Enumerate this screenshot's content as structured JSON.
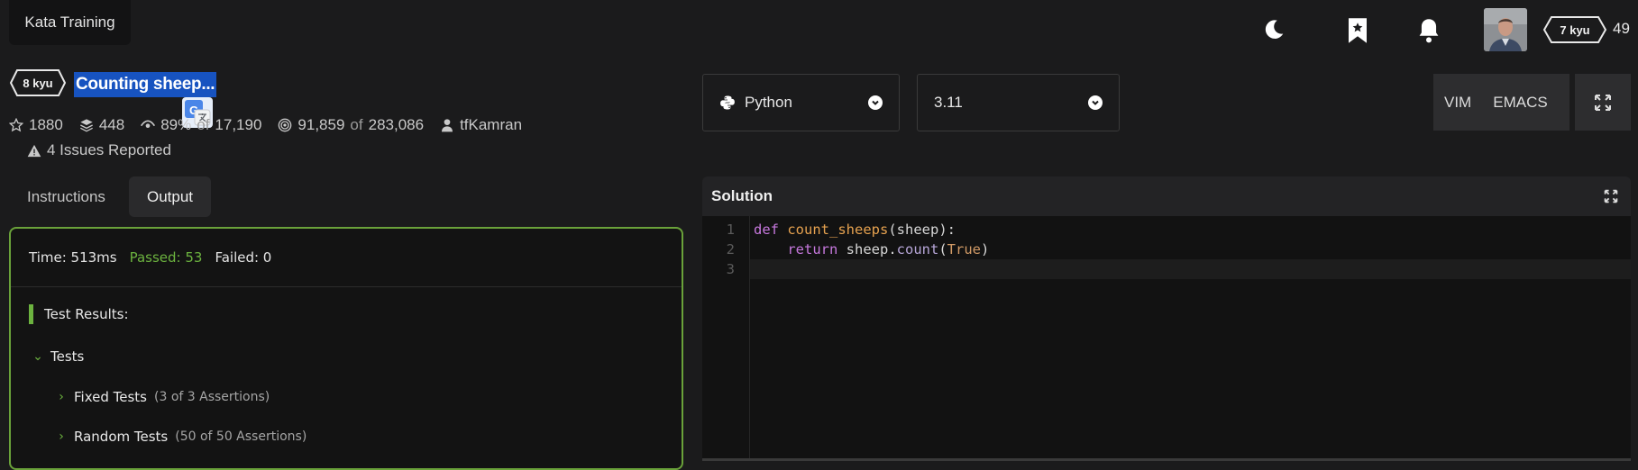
{
  "app": {
    "brand": "Kata Training"
  },
  "header": {
    "rank": "7 kyu",
    "honor": "49",
    "colors": {
      "background": "#1b1b1c",
      "highlight": "#1753c0"
    }
  },
  "kata": {
    "rank": "8 kyu",
    "title": "Counting sheep...",
    "stats": {
      "stars": "1880",
      "collections": "448",
      "satisfaction": "89%",
      "satisfaction_of": "of",
      "votes": "17,190",
      "completed": "91,859",
      "completed_of": "of",
      "attempts": "283,086",
      "author": "tfKamran"
    },
    "issues": "4 Issues Reported"
  },
  "tabs": [
    {
      "label": "Instructions",
      "active": false
    },
    {
      "label": "Output",
      "active": true
    }
  ],
  "output": {
    "time": "Time: 513ms",
    "passed": "Passed: 53",
    "failed": "Failed: 0",
    "results_title": "Test Results:",
    "group": "Tests",
    "items": [
      {
        "name": "Fixed Tests",
        "detail": "(3 of 3 Assertions)"
      },
      {
        "name": "Random Tests",
        "detail": "(50 of 50 Assertions)"
      }
    ],
    "colors": {
      "pass": "#6cb33f",
      "border": "#6aa23a"
    }
  },
  "language": {
    "selected": "Python",
    "version": "3.11"
  },
  "modes": {
    "vim": "VIM",
    "emacs": "EMACS"
  },
  "solution": {
    "title": "Solution",
    "line_numbers": [
      "1",
      "2",
      "3"
    ],
    "code": {
      "def": "def",
      "fn_name": "count_sheeps",
      "params": "(sheep):",
      "indent": "    ",
      "ret": "return",
      "obj": " sheep.",
      "method": "count",
      "open": "(",
      "arg": "True",
      "close": ")"
    }
  }
}
